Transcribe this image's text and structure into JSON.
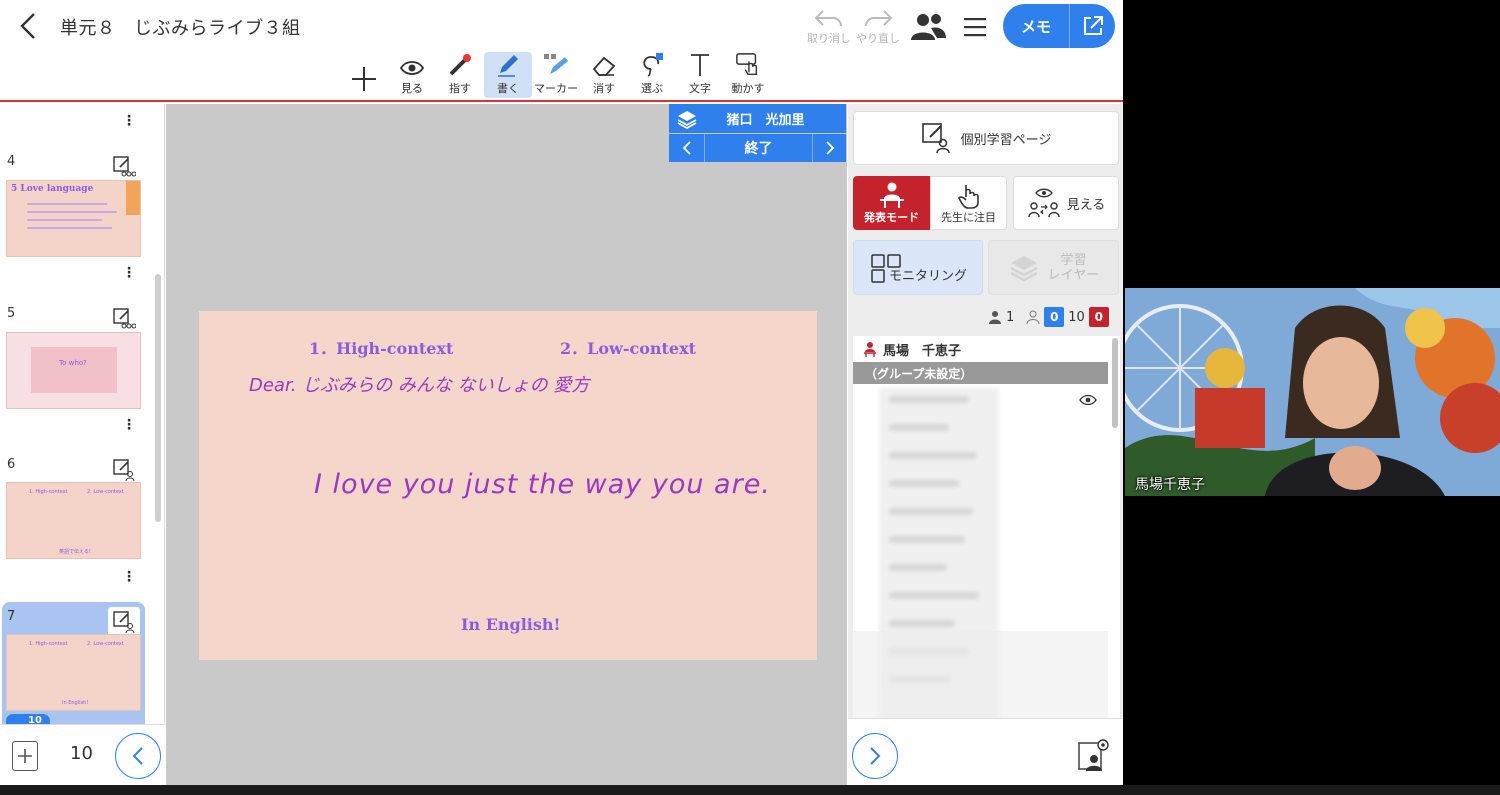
{
  "header": {
    "title": "単元８　じぶみらライブ３組",
    "undo_label": "取り消し",
    "redo_label": "やり直し",
    "memo_label": "メモ"
  },
  "toolbar": {
    "tools": [
      {
        "label": ""
      },
      {
        "label": "見る"
      },
      {
        "label": "指す"
      },
      {
        "label": "書く"
      },
      {
        "label": "マーカー"
      },
      {
        "label": "消す"
      },
      {
        "label": "選ぶ"
      },
      {
        "label": "文字"
      },
      {
        "label": "動かす"
      }
    ]
  },
  "left_panel": {
    "slides": [
      {
        "number": "4",
        "title": "5 Love language"
      },
      {
        "number": "5",
        "text": "To who?"
      },
      {
        "number": "6",
        "h1": "1. High-context",
        "h2": "2. Low-context",
        "footer": "英語で伝える!"
      },
      {
        "number": "7",
        "h1": "1. High-context",
        "h2": "2. Low-context",
        "footer": "In English!"
      }
    ],
    "selected_badge": "10",
    "page_count": "10"
  },
  "canvas": {
    "slide": {
      "heading_1": "1．High-context",
      "heading_2": "2．Low-context",
      "handwriting_line_1": "Dear.  じぶみらの みんな  ないしょの 愛方",
      "handwriting_line_2": "I love you just the way you are.",
      "footer": "In English!"
    },
    "presenter": {
      "name": "猪口　光加里",
      "end_label": "終了"
    }
  },
  "right_panel": {
    "individual_page_label": "個別学習ページ",
    "present_mode_label": "発表モード",
    "attention_label": "先生に注目",
    "visible_label": "見える",
    "monitoring_label": "モニタリング",
    "layer_label_1": "学習",
    "layer_label_2": "レイヤー",
    "counts": {
      "teachers": "1",
      "blue": "0",
      "students": "10",
      "red": "0"
    },
    "teacher_name": "馬場　千恵子",
    "group_label": "（グループ未設定）"
  },
  "video": {
    "participant_name": "馬場千恵子"
  },
  "colors": {
    "accent_blue": "#2f80ed",
    "accent_red": "#c4232e",
    "slide_bg": "#f4d6ca",
    "slide_heading": "#8a5de0",
    "ink": "#9b38c2"
  }
}
